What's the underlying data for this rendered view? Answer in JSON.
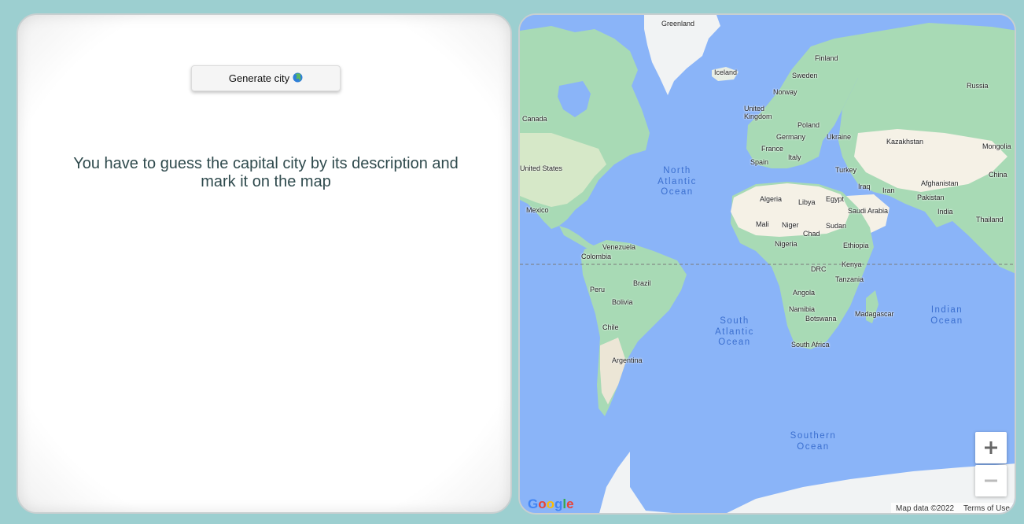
{
  "left_panel": {
    "generate_button_label": "Generate city",
    "generate_button_emoji": "🌏",
    "instructions": "You have to guess the capital city by its description and mark it on the map"
  },
  "map": {
    "labels": {
      "greenland": "Greenland",
      "iceland": "Iceland",
      "finland": "Finland",
      "sweden": "Sweden",
      "norway": "Norway",
      "russia": "Russia",
      "canada": "Canada",
      "united_kingdom": "United\nKingdom",
      "poland": "Poland",
      "germany": "Germany",
      "ukraine": "Ukraine",
      "kazakhstan": "Kazakhstan",
      "mongolia": "Mongolia",
      "france": "France",
      "spain": "Spain",
      "italy": "Italy",
      "turkey": "Turkey",
      "united_states": "United States",
      "china": "China",
      "afghanistan": "Afghanistan",
      "iraq": "Iraq",
      "iran": "Iran",
      "pakistan": "Pakistan",
      "algeria": "Algeria",
      "libya": "Libya",
      "egypt": "Egypt",
      "saudi_arabia": "Saudi Arabia",
      "india": "India",
      "thailand": "Thailand",
      "mexico": "Mexico",
      "mali": "Mali",
      "niger": "Niger",
      "chad": "Chad",
      "sudan": "Sudan",
      "venezuela": "Venezuela",
      "nigeria": "Nigeria",
      "ethiopia": "Ethiopia",
      "colombia": "Colombia",
      "kenya": "Kenya",
      "drc": "DRC",
      "tanzania": "Tanzania",
      "brazil": "Brazil",
      "peru": "Peru",
      "angola": "Angola",
      "bolivia": "Bolivia",
      "namibia": "Namibia",
      "madagascar": "Madagascar",
      "botswana": "Botswana",
      "chile": "Chile",
      "south_africa": "South Africa",
      "argentina": "Argentina"
    },
    "oceans": {
      "north_atlantic": "North\nAtlantic\nOcean",
      "south_atlantic": "South\nAtlantic\nOcean",
      "indian": "Indian\nOcean",
      "southern": "Southern\nOcean"
    },
    "zoom_in_label": "+",
    "zoom_out_label": "−",
    "google_logo": "Google",
    "map_data": "Map data ©2022",
    "terms": "Terms of Use"
  },
  "colors": {
    "background": "#9ccfd0",
    "ocean": "#8ab4f8",
    "land": "#f5f1e6",
    "vegetation": "#a8dab5",
    "ice": "#f1f3f4"
  }
}
